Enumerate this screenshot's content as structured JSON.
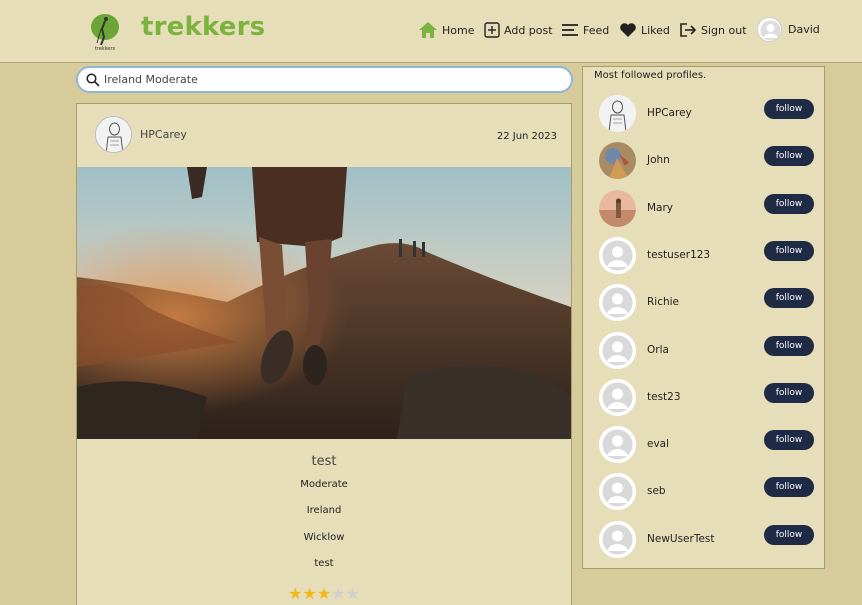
{
  "brand": {
    "name": "trekkers",
    "logo_text": "trekkers",
    "color": "#7bb33f"
  },
  "nav": {
    "home": "Home",
    "add_post": "Add post",
    "feed": "Feed",
    "liked": "Liked",
    "sign_out": "Sign out",
    "user": "David"
  },
  "search": {
    "value": "Ireland Moderate",
    "icon": "search-icon"
  },
  "post": {
    "owner": "HPCarey",
    "date": "22 Jun 2023",
    "title": "test",
    "difficulty": "Moderate",
    "country": "Ireland",
    "county": "Wicklow",
    "description": "test",
    "rating": 3,
    "rating_max": 5
  },
  "profiles": {
    "title": "Most followed profiles.",
    "follow_label": "follow",
    "items": [
      {
        "name": "HPCarey",
        "avatar": "sketch"
      },
      {
        "name": "John",
        "avatar": "photo-warm"
      },
      {
        "name": "Mary",
        "avatar": "photo-sunset"
      },
      {
        "name": "testuser123",
        "avatar": "default"
      },
      {
        "name": "Richie",
        "avatar": "default"
      },
      {
        "name": "Orla",
        "avatar": "default"
      },
      {
        "name": "test23",
        "avatar": "default"
      },
      {
        "name": "eval",
        "avatar": "default"
      },
      {
        "name": "seb",
        "avatar": "default"
      },
      {
        "name": "NewUserTest",
        "avatar": "default"
      }
    ]
  },
  "colors": {
    "page_bg": "#d8cb9b",
    "panel_bg": "#e6deb8",
    "button_bg": "#1f2a44",
    "star_on": "#f2b818",
    "star_off": "#cfcfcf"
  }
}
